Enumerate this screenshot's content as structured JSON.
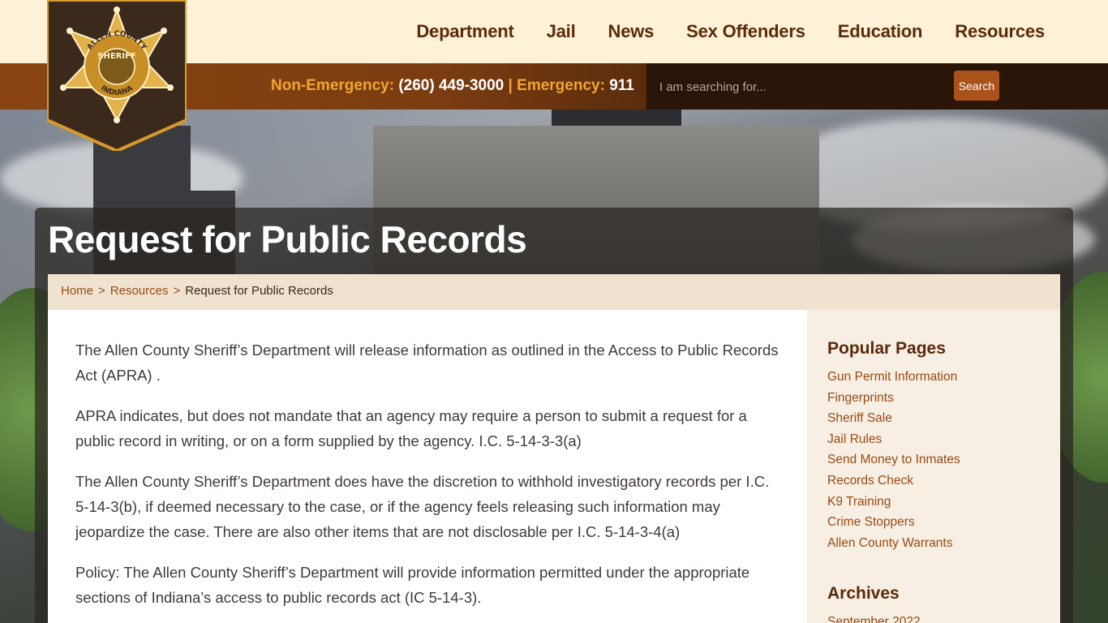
{
  "nav": {
    "items": [
      {
        "label": "Department"
      },
      {
        "label": "Jail"
      },
      {
        "label": "News"
      },
      {
        "label": "Sex Offenders"
      },
      {
        "label": "Education"
      },
      {
        "label": "Resources"
      }
    ]
  },
  "contact": {
    "non_emergency_label": "Non-Emergency:",
    "non_emergency_number": "(260) 449-3000",
    "separator": "|",
    "emergency_label": "Emergency:",
    "emergency_number": "911"
  },
  "badge": {
    "top_text": "ALLEN COUNTY",
    "middle_text": "SHERIFF",
    "bottom_text": "INDIANA"
  },
  "search": {
    "placeholder": "I am searching for...",
    "button_label": "Search"
  },
  "page": {
    "title": "Request for Public Records"
  },
  "breadcrumb": {
    "home": "Home",
    "separator": ">",
    "resources": "Resources",
    "current": "Request for Public Records"
  },
  "content": {
    "paragraphs": [
      "The Allen County Sheriff’s Department will release information as outlined in the Access to Public Records Act (APRA) .",
      "APRA indicates, but does not mandate that an agency may require a person to submit a request for a public record in writing, or on a form supplied by the agency. I.C. 5-14-3-3(a)",
      "The Allen County Sheriff’s Department does have the discretion to withhold investigatory  records per I.C. 5-14-3(b), if deemed necessary to the case, or if the agency feels releasing such information may jeopardize the case.  There are also other items that are not disclosable per I.C. 5-14-3-4(a)",
      "Policy: The Allen County Sheriff’s Department will provide information permitted under the appropriate sections of Indiana’s access to public records act (IC 5-14-3)."
    ]
  },
  "sidebar": {
    "popular_title": "Popular Pages",
    "popular": [
      "Gun Permit Information",
      "Fingerprints",
      "Sheriff Sale",
      "Jail Rules",
      "Send Money to Inmates",
      "Records Check",
      "K9 Training",
      "Crime Stoppers",
      "Allen County Warrants"
    ],
    "archives_title": "Archives",
    "archives": [
      "September 2022"
    ]
  },
  "colors": {
    "nav_text": "#5a2a0c",
    "top_bar": "#fdf1d7",
    "accent_orange": "#f2a531",
    "link": "#9a4a12",
    "button": "#a9531a"
  }
}
